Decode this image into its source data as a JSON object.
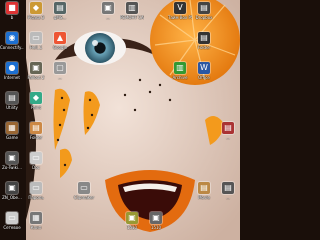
{
  "desktop": {
    "colors": {
      "skin": "#e8d2c4",
      "orange": "#f39a1c",
      "lips": "#e36b0f",
      "iris": "#3a6f86",
      "hair": "#2a1a12"
    },
    "icons": [
      {
        "label": "b",
        "glyph": "■",
        "color": "#d33"
      },
      {
        "label": "Picasa 3",
        "glyph": "◆",
        "color": "#c93"
      },
      {
        "label": "gMS...",
        "glyph": "▤",
        "color": "#566"
      },
      {
        "label": "",
        "glyph": "",
        "color": ""
      },
      {
        "label": "...",
        "glyph": "▣",
        "color": "#777"
      },
      {
        "label": "РЕМОНТ CASIO",
        "glyph": "▥",
        "color": "#555"
      },
      {
        "label": "",
        "glyph": "",
        "color": ""
      },
      {
        "label": "Тайм Box PSKit",
        "glyph": "V",
        "color": "#333"
      },
      {
        "label": "Dropbox",
        "glyph": "▤",
        "color": "#444"
      },
      {
        "label": "",
        "glyph": "",
        "color": ""
      },
      {
        "label": "Connectify...",
        "glyph": "◉",
        "color": "#1c6fd1"
      },
      {
        "label": "Hell_1",
        "glyph": "▭",
        "color": "#bbb"
      },
      {
        "label": "Google",
        "glyph": "▲",
        "color": "#e53"
      },
      {
        "label": "",
        "glyph": "",
        "color": ""
      },
      {
        "label": "",
        "glyph": "",
        "color": ""
      },
      {
        "label": "",
        "glyph": "",
        "color": ""
      },
      {
        "label": "",
        "glyph": "",
        "color": ""
      },
      {
        "label": "",
        "glyph": "",
        "color": ""
      },
      {
        "label": "Folder",
        "glyph": "▤",
        "color": "#333"
      },
      {
        "label": "",
        "glyph": "",
        "color": ""
      },
      {
        "label": "Internet",
        "glyph": "●",
        "color": "#1c6fd1"
      },
      {
        "label": "Fallout 2",
        "glyph": "▣",
        "color": "#665"
      },
      {
        "label": "...",
        "glyph": "▢",
        "color": "#999"
      },
      {
        "label": "",
        "glyph": "",
        "color": ""
      },
      {
        "label": "",
        "glyph": "",
        "color": ""
      },
      {
        "label": "",
        "glyph": "",
        "color": ""
      },
      {
        "label": "",
        "glyph": "",
        "color": ""
      },
      {
        "label": "Archive",
        "glyph": "▥",
        "color": "#393"
      },
      {
        "label": "Office",
        "glyph": "W",
        "color": "#2a57a3"
      },
      {
        "label": "",
        "glyph": "",
        "color": ""
      },
      {
        "label": "Utility",
        "glyph": "▤",
        "color": "#555"
      },
      {
        "label": "Paint",
        "glyph": "◆",
        "color": "#3a8"
      },
      {
        "label": "",
        "glyph": "",
        "color": ""
      },
      {
        "label": "",
        "glyph": "",
        "color": ""
      },
      {
        "label": "",
        "glyph": "",
        "color": ""
      },
      {
        "label": "",
        "glyph": "",
        "color": ""
      },
      {
        "label": "",
        "glyph": "",
        "color": ""
      },
      {
        "label": "",
        "glyph": "",
        "color": ""
      },
      {
        "label": "",
        "glyph": "",
        "color": ""
      },
      {
        "label": "",
        "glyph": "",
        "color": ""
      },
      {
        "label": "Game",
        "glyph": "▦",
        "color": "#963"
      },
      {
        "label": "Folder",
        "glyph": "▤",
        "color": "#c84"
      },
      {
        "label": "",
        "glyph": "",
        "color": ""
      },
      {
        "label": "",
        "glyph": "",
        "color": ""
      },
      {
        "label": "",
        "glyph": "",
        "color": ""
      },
      {
        "label": "",
        "glyph": "",
        "color": ""
      },
      {
        "label": "",
        "glyph": "",
        "color": ""
      },
      {
        "label": "",
        "glyph": "",
        "color": ""
      },
      {
        "label": "",
        "glyph": "",
        "color": ""
      },
      {
        "label": "...",
        "glyph": "▤",
        "color": "#a33"
      },
      {
        "label": "Zo-Twiki...",
        "glyph": "▣",
        "color": "#555"
      },
      {
        "label": "Doc",
        "glyph": "▭",
        "color": "#ccc"
      },
      {
        "label": "",
        "glyph": "",
        "color": ""
      },
      {
        "label": "",
        "glyph": "",
        "color": ""
      },
      {
        "label": "",
        "glyph": "",
        "color": ""
      },
      {
        "label": "",
        "glyph": "",
        "color": ""
      },
      {
        "label": "",
        "glyph": "",
        "color": ""
      },
      {
        "label": "",
        "glyph": "",
        "color": ""
      },
      {
        "label": "",
        "glyph": "",
        "color": ""
      },
      {
        "label": "",
        "glyph": "",
        "color": ""
      },
      {
        "label": "ZN_Obe...",
        "glyph": "▣",
        "color": "#444"
      },
      {
        "label": "Пароль",
        "glyph": "▭",
        "color": "#bbb"
      },
      {
        "label": "",
        "glyph": "",
        "color": ""
      },
      {
        "label": "Clipmaker",
        "glyph": "▭",
        "color": "#888"
      },
      {
        "label": "",
        "glyph": "",
        "color": ""
      },
      {
        "label": "",
        "glyph": "",
        "color": ""
      },
      {
        "label": "",
        "glyph": "",
        "color": ""
      },
      {
        "label": "",
        "glyph": "",
        "color": ""
      },
      {
        "label": "Movie",
        "glyph": "▤",
        "color": "#b84"
      },
      {
        "label": "...",
        "glyph": "▤",
        "color": "#555"
      },
      {
        "label": "Сетевое",
        "glyph": "▭",
        "color": "#ccc"
      },
      {
        "label": "Клип",
        "glyph": "▦",
        "color": "#777"
      },
      {
        "label": "",
        "glyph": "",
        "color": ""
      },
      {
        "label": "",
        "glyph": "",
        "color": ""
      },
      {
        "label": "",
        "glyph": "",
        "color": ""
      },
      {
        "label": "1510",
        "glyph": "▣",
        "color": "#993"
      },
      {
        "label": "1510",
        "glyph": "▣",
        "color": "#666"
      },
      {
        "label": "",
        "glyph": "",
        "color": ""
      },
      {
        "label": "",
        "glyph": "",
        "color": ""
      },
      {
        "label": "",
        "glyph": "",
        "color": ""
      }
    ]
  }
}
